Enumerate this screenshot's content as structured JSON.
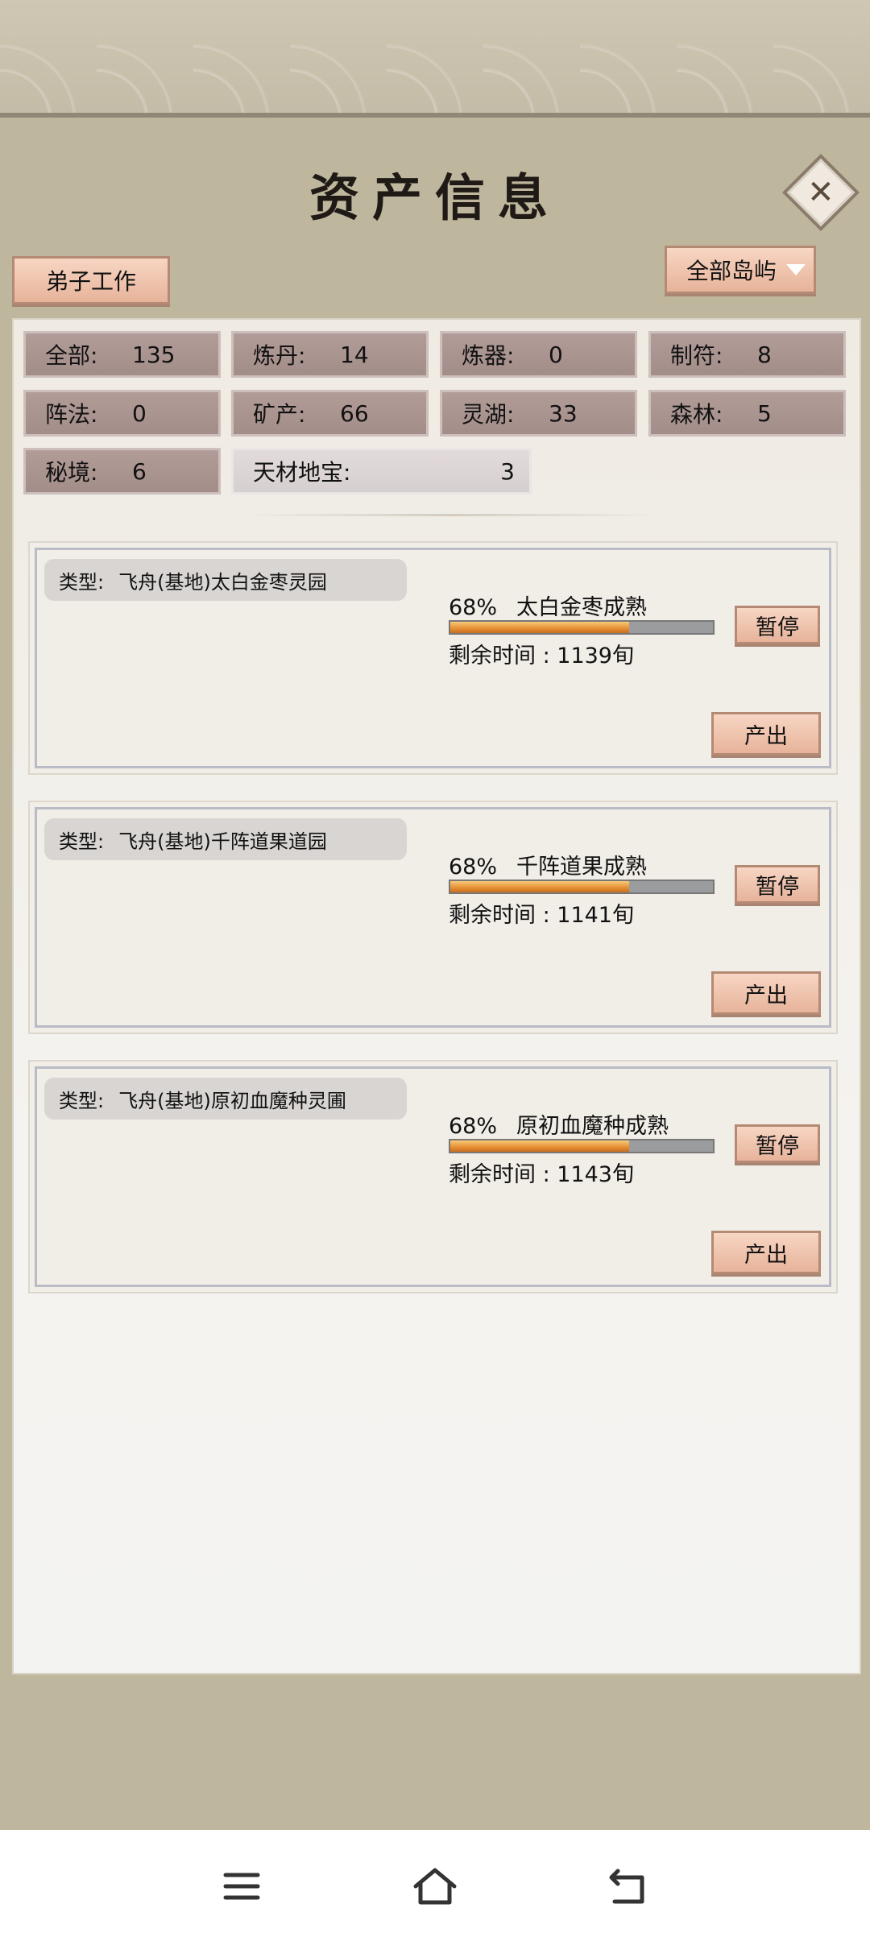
{
  "title": "资产信息",
  "tab_button": "弟子工作",
  "island_filter": "全部岛屿",
  "stats": [
    {
      "label": "全部:",
      "value": "135"
    },
    {
      "label": "炼丹:",
      "value": "14"
    },
    {
      "label": "炼器:",
      "value": "0"
    },
    {
      "label": "制符:",
      "value": "8"
    },
    {
      "label": "阵法:",
      "value": "0"
    },
    {
      "label": "矿产:",
      "value": "66"
    },
    {
      "label": "灵湖:",
      "value": "33"
    },
    {
      "label": "森林:",
      "value": "5"
    },
    {
      "label": "秘境:",
      "value": "6"
    },
    {
      "label": "天材地宝:",
      "value": "3"
    }
  ],
  "assets": [
    {
      "type_label": "类型:",
      "type": "飞舟(基地)太白金枣灵园",
      "percent": "68%",
      "progress": 0.68,
      "status": "太白金枣成熟",
      "remaining": "剩余时间 : 1139旬",
      "pause": "暂停",
      "output": "产出"
    },
    {
      "type_label": "类型:",
      "type": "飞舟(基地)千阵道果道园",
      "percent": "68%",
      "progress": 0.68,
      "status": "千阵道果成熟",
      "remaining": "剩余时间 : 1141旬",
      "pause": "暂停",
      "output": "产出"
    },
    {
      "type_label": "类型:",
      "type": "飞舟(基地)原初血魔种灵圃",
      "percent": "68%",
      "progress": 0.68,
      "status": "原初血魔种成熟",
      "remaining": "剩余时间 : 1143旬",
      "pause": "暂停",
      "output": "产出"
    }
  ],
  "nav": {
    "menu": "menu-icon",
    "home": "home-icon",
    "back": "back-icon"
  },
  "colors": {
    "accent": "#e7b39a",
    "progress": "#e58e33"
  }
}
